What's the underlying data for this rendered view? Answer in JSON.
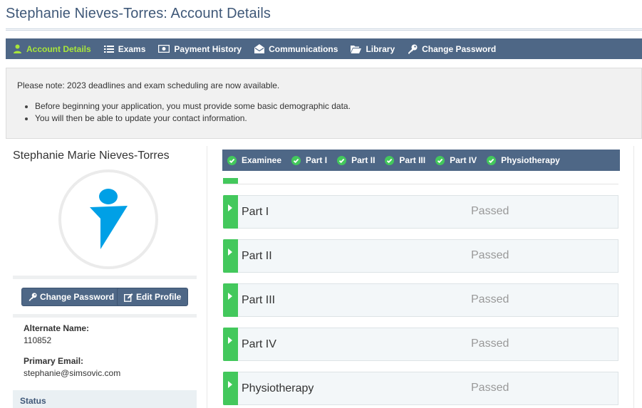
{
  "page": {
    "title": "Stephanie Nieves-Torres: Account Details"
  },
  "nav": {
    "items": [
      {
        "label": "Account Details",
        "icon": "user-icon",
        "active": true
      },
      {
        "label": "Exams",
        "icon": "list-icon"
      },
      {
        "label": "Payment History",
        "icon": "money-icon"
      },
      {
        "label": "Communications",
        "icon": "envelope-open-icon"
      },
      {
        "label": "Library",
        "icon": "folder-open-icon"
      },
      {
        "label": "Change Password",
        "icon": "key-icon"
      }
    ],
    "active_color": "#a8e63a",
    "bar_color": "#4e6786"
  },
  "notice": {
    "text": "Please note: 2023 deadlines and exam scheduling are now available.",
    "bullets": [
      "Before beginning your application, you must provide some basic demographic data.",
      "You will then be able to update your contact information."
    ]
  },
  "profile": {
    "full_name": "Stephanie Marie Nieves-Torres",
    "avatar_icon": "person-silhouette-icon",
    "avatar_color": "#00a0e6",
    "change_password_label": "Change Password",
    "edit_profile_label": "Edit Profile",
    "alternate_name_label": "Alternate Name:",
    "alternate_name_value": "110852",
    "primary_email_label": "Primary Email:",
    "primary_email_value": "stephanie@simsovic.com",
    "status_label": "Status"
  },
  "progress": {
    "steps": [
      {
        "label": "Examinee",
        "icon": "check-circle-icon"
      },
      {
        "label": "Part I",
        "icon": "check-circle-icon"
      },
      {
        "label": "Part II",
        "icon": "check-circle-icon"
      },
      {
        "label": "Part III",
        "icon": "check-circle-icon"
      },
      {
        "label": "Part IV",
        "icon": "check-circle-icon"
      },
      {
        "label": "Physiotherapy",
        "icon": "check-circle-icon"
      }
    ],
    "check_color": "#43c85c"
  },
  "exams": [
    {
      "name": "Part I",
      "status": "Passed"
    },
    {
      "name": "Part II",
      "status": "Passed"
    },
    {
      "name": "Part III",
      "status": "Passed"
    },
    {
      "name": "Part IV",
      "status": "Passed"
    },
    {
      "name": "Physiotherapy",
      "status": "Passed"
    }
  ]
}
